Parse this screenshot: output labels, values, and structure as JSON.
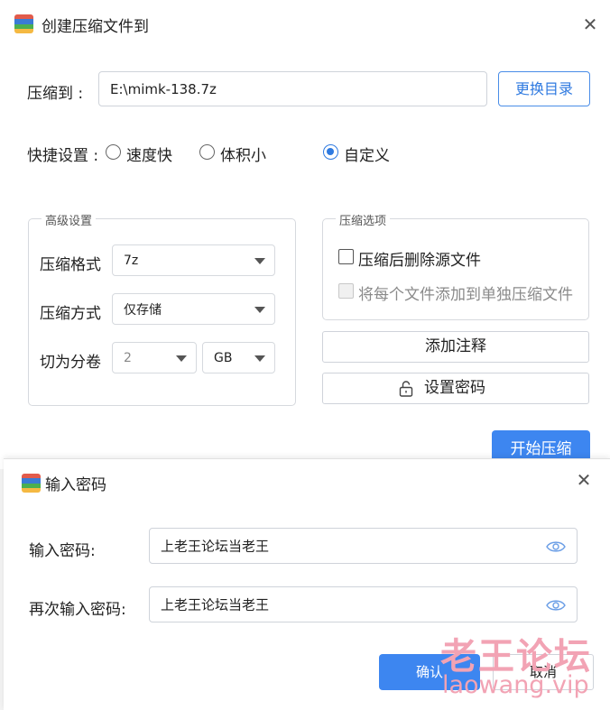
{
  "compress_dialog": {
    "title": "创建压缩文件到",
    "path_label": "压缩到 :",
    "path_value": "E:\\mimk-138.7z",
    "change_dir_button": "更换目录",
    "quick_label": "快捷设置 :",
    "quick_options": [
      "速度快",
      "体积小",
      "自定义"
    ],
    "quick_selected": "自定义",
    "advanced": {
      "title": "高级设置",
      "format_label": "压缩格式",
      "format_value": "7z",
      "method_label": "压缩方式",
      "method_value": "仅存储",
      "split_label": "切为分卷",
      "split_value": "2",
      "split_unit": "GB"
    },
    "options": {
      "title": "压缩选项",
      "delete_source_label": "压缩后删除源文件",
      "separate_archive_label": "将每个文件添加到单独压缩文件"
    },
    "add_comment_button": "添加注释",
    "set_password_button": "设置密码",
    "start_button": "开始压缩"
  },
  "password_dialog": {
    "title": "输入密码",
    "password_label": "输入密码:",
    "password_value": "上老王论坛当老王",
    "confirm_label": "再次输入密码:",
    "confirm_value": "上老王论坛当老王",
    "ok_button": "确认",
    "cancel_button": "取消"
  },
  "watermark": {
    "title": "老王论坛",
    "url": "laowang.vip"
  },
  "colors": {
    "accent": "#3d86f0",
    "watermark": "#f2a3b4"
  },
  "icons": [
    "app-icon",
    "close-icon",
    "lock-icon",
    "eye-icon",
    "chevron-down-icon"
  ]
}
